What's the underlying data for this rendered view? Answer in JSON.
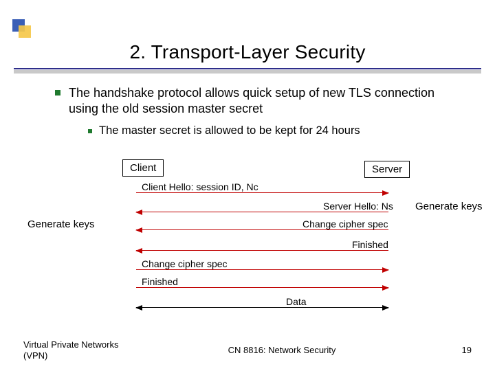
{
  "title": "2. Transport-Layer Security",
  "bullets": {
    "l1": "The handshake protocol allows quick setup of new TLS connection using the old session master secret",
    "l2": "The master secret is allowed to be kept for 24 hours"
  },
  "diagram": {
    "client_box": "Client",
    "server_box": "Server",
    "gen_keys_left": "Generate keys",
    "gen_keys_right": "Generate keys",
    "arrows": {
      "a1": "Client Hello: session ID, Nc",
      "a2": "Server Hello:  Ns",
      "a3": "Change cipher spec",
      "a4": "Finished",
      "a5": "Change cipher spec",
      "a6": "Finished",
      "a7": "Data"
    }
  },
  "footer": {
    "left": "Virtual Private Networks (VPN)",
    "center": "CN 8816: Network Security",
    "page": "19"
  }
}
